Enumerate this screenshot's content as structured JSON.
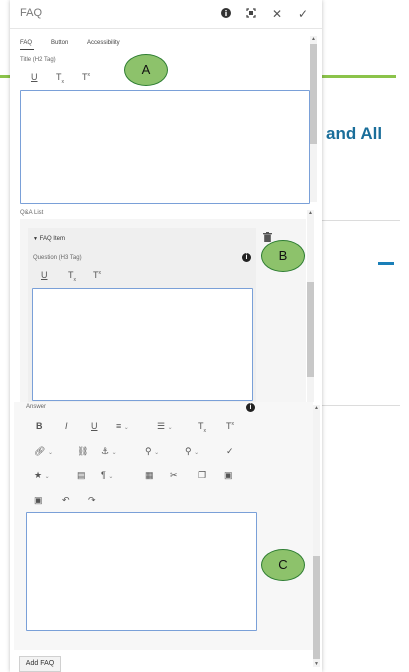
{
  "background": {
    "heading_fragment": "and All"
  },
  "dialog": {
    "title": "FAQ",
    "tabs": [
      "FAQ",
      "Button",
      "Accessibility"
    ],
    "title_label": "Title (H2 Tag)",
    "qa_list_label": "Q&A List",
    "faq_item_label": "FAQ Item",
    "question_label": "Question (H3 Tag)",
    "answer_label": "Answer",
    "add_button": "Add FAQ"
  },
  "annotations": [
    "A",
    "B",
    "C"
  ],
  "icons": {
    "titlebar": [
      "info-icon",
      "fullscreen-icon",
      "close-icon",
      "check-icon"
    ],
    "format_small": [
      "underline-icon",
      "subscript-icon",
      "superscript-icon"
    ]
  },
  "colors": {
    "accent_green": "#8bc34a",
    "heading_blue": "#1a6e9a",
    "annotation_fill": "#8dc26b",
    "field_border": "#7aa0d8"
  }
}
